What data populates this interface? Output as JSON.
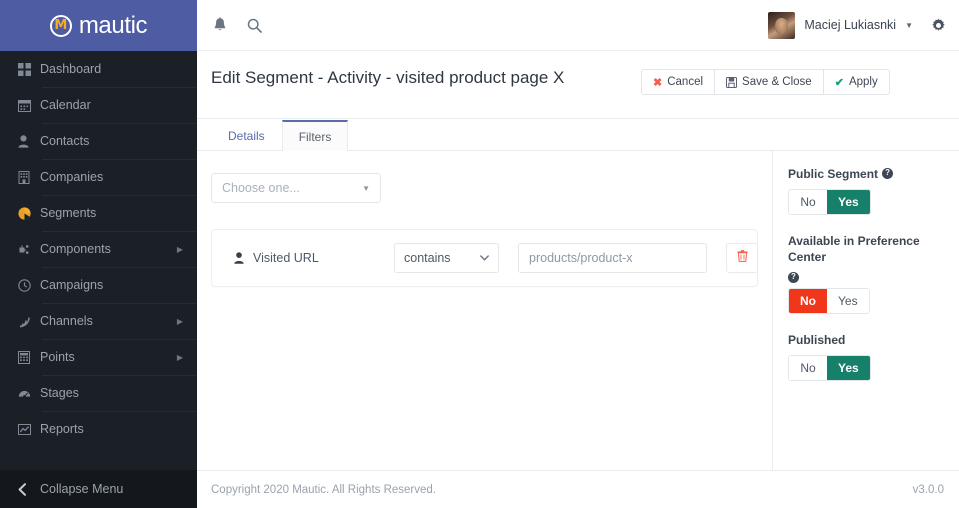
{
  "brand": {
    "mark": "M",
    "name": "mautic"
  },
  "sidebar": {
    "items": [
      {
        "label": "Dashboard",
        "icon": "grid-icon",
        "caret": ""
      },
      {
        "label": "Calendar",
        "icon": "calendar-icon",
        "caret": ""
      },
      {
        "label": "Contacts",
        "icon": "person-icon",
        "caret": ""
      },
      {
        "label": "Companies",
        "icon": "building-icon",
        "caret": ""
      },
      {
        "label": "Segments",
        "icon": "pie-chart-icon",
        "caret": ""
      },
      {
        "label": "Components",
        "icon": "components-icon",
        "caret": "▶"
      },
      {
        "label": "Campaigns",
        "icon": "clock-icon",
        "caret": ""
      },
      {
        "label": "Channels",
        "icon": "rss-icon",
        "caret": "▶"
      },
      {
        "label": "Points",
        "icon": "calculator-icon",
        "caret": "▶"
      },
      {
        "label": "Stages",
        "icon": "gauge-icon",
        "caret": ""
      },
      {
        "label": "Reports",
        "icon": "chart-line-icon",
        "caret": ""
      }
    ],
    "collapse": {
      "label": "Collapse Menu",
      "icon": "chevron-left-icon"
    }
  },
  "topbar": {
    "notifications_icon": "bell-icon",
    "search_icon": "search-icon",
    "user_name": "Maciej Lukiasnki",
    "user_caret": "▼",
    "settings_icon": "gear-icon",
    "avatar": "user-avatar"
  },
  "page": {
    "title": "Edit Segment - Activity - visited product page X",
    "buttons": [
      {
        "label": "Cancel",
        "icon": "x-icon"
      },
      {
        "label": "Save & Close",
        "icon": "save-icon"
      },
      {
        "label": "Apply",
        "icon": "check-icon"
      }
    ],
    "tabs": [
      {
        "label": "Details",
        "active": false
      },
      {
        "label": "Filters",
        "active": true
      }
    ]
  },
  "filters": {
    "chooser": {
      "placeholder": "Choose one...",
      "caret": "▼"
    },
    "rows": [
      {
        "name": "Visited URL",
        "icon": "person-icon",
        "operator": "contains",
        "operator_caret": "⌄",
        "value": "products/product-x",
        "delete_icon": "trash-icon"
      }
    ]
  },
  "rail": {
    "groups": [
      {
        "label": "Public Segment",
        "help": "?",
        "options": [
          {
            "label": "No",
            "state": "off"
          },
          {
            "label": "Yes",
            "state": "green"
          }
        ]
      },
      {
        "label": "Available in Preference Center",
        "help": "?",
        "options": [
          {
            "label": "No",
            "state": "red"
          },
          {
            "label": "Yes",
            "state": "off"
          }
        ]
      },
      {
        "label": "Published",
        "help": "",
        "options": [
          {
            "label": "No",
            "state": "off"
          },
          {
            "label": "Yes",
            "state": "green"
          }
        ]
      }
    ]
  },
  "footer": {
    "copyright": "Copyright 2020 Mautic. All Rights Reserved.",
    "version": "v3.0.0"
  },
  "colors": {
    "brand_blue": "#4e5ca3",
    "sidebar_dark": "#1b2026",
    "accent_amber": "#f7ab28",
    "green": "#17806a",
    "red": "#f1371b",
    "tab_active": "#5b6ab0",
    "danger": "#f2614c"
  }
}
